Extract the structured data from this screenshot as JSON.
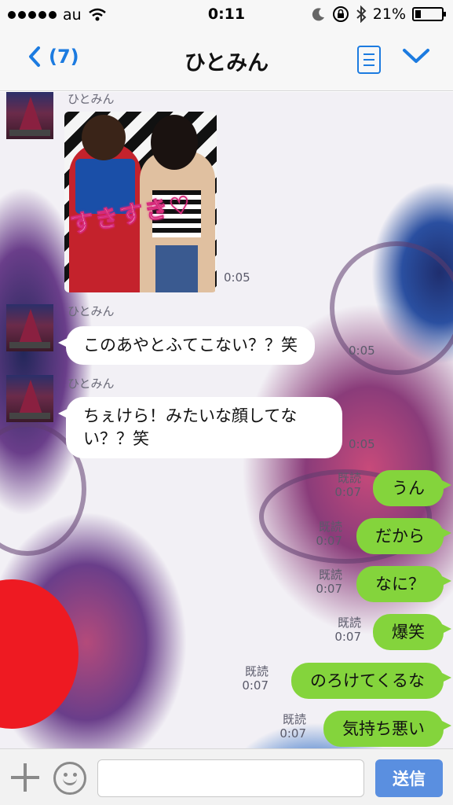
{
  "status_bar": {
    "carrier": "au",
    "time": "0:11",
    "battery": "21%",
    "battery_level": 0.21
  },
  "nav": {
    "back_label": "(7)",
    "title": "ひとみん"
  },
  "messages": [
    {
      "side": "left",
      "sender": "ひとみん",
      "type": "photo",
      "photo_caption": "すきすき♡",
      "time": "0:05"
    },
    {
      "side": "left",
      "sender": "ひとみん",
      "text": "このあやとふてこない？？笑",
      "time": "0:05"
    },
    {
      "side": "left",
      "sender": "ひとみん",
      "text_line1": "ちぇけら！みたいな顔してな",
      "text_line2": "い？？笑",
      "time": "0:05"
    },
    {
      "side": "right",
      "read": "既読",
      "time": "0:07",
      "text": "うん"
    },
    {
      "side": "right",
      "read": "既読",
      "time": "0:07",
      "text": "だから"
    },
    {
      "side": "right",
      "read": "既読",
      "time": "0:07",
      "text": "なに？"
    },
    {
      "side": "right",
      "read": "既読",
      "time": "0:07",
      "text": "爆笑"
    },
    {
      "side": "right",
      "read": "既読",
      "time": "0:07",
      "text": "のろけてくるな"
    },
    {
      "side": "right",
      "read": "既読",
      "time": "0:07",
      "text": "気持ち悪い"
    }
  ],
  "input_bar": {
    "placeholder": "",
    "send_label": "送信"
  },
  "colors": {
    "accent": "#1c7be0",
    "my_bubble": "#84d43c",
    "send_button": "#5a8fe0"
  }
}
